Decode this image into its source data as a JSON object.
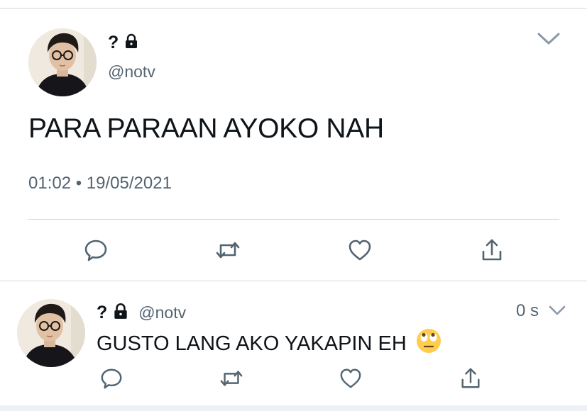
{
  "tweet": {
    "display_name": "?",
    "handle": "@notv",
    "text": "PARA PARAAN AYOKO NAH",
    "timestamp": "01:02 • 19/05/2021"
  },
  "reply": {
    "display_name": "?",
    "handle": "@notv",
    "time_ago": "0 s",
    "text": "GUSTO LANG AKO YAKAPIN EH",
    "emoji": "face-with-rolling-eyes"
  },
  "icons": {
    "reply": "speech-bubble-icon",
    "retweet": "retweet-icon",
    "like": "heart-icon",
    "share": "share-icon",
    "more": "chevron-down-icon",
    "protected": "lock-icon"
  },
  "colors": {
    "text": "#0f1419",
    "muted": "#536471",
    "icon": "#536471",
    "divider": "#cfd9de"
  }
}
